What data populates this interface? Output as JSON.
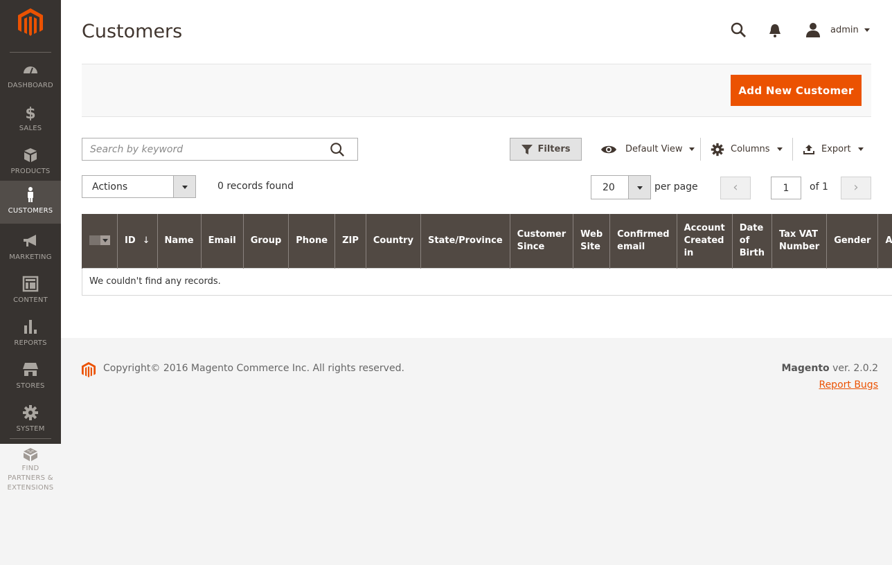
{
  "sidebar": {
    "items": [
      {
        "label": "DASHBOARD",
        "icon": "dashboard-icon",
        "active": false
      },
      {
        "label": "SALES",
        "icon": "dollar-icon",
        "active": false
      },
      {
        "label": "PRODUCTS",
        "icon": "box-icon",
        "active": false
      },
      {
        "label": "CUSTOMERS",
        "icon": "person-icon",
        "active": true
      },
      {
        "label": "MARKETING",
        "icon": "megaphone-icon",
        "active": false
      },
      {
        "label": "CONTENT",
        "icon": "layout-icon",
        "active": false
      },
      {
        "label": "REPORTS",
        "icon": "bar-chart-icon",
        "active": false
      },
      {
        "label": "STORES",
        "icon": "storefront-icon",
        "active": false
      },
      {
        "label": "SYSTEM",
        "icon": "gear-icon",
        "active": false
      }
    ],
    "partners_label_1": "FIND",
    "partners_label_2": "PARTNERS &",
    "partners_label_3": "EXTENSIONS"
  },
  "header": {
    "title": "Customers",
    "user": "admin"
  },
  "action_bar": {
    "add_button": "Add New Customer"
  },
  "toolbar": {
    "search_placeholder": "Search by keyword",
    "search_value": "",
    "filters": "Filters",
    "view": "Default View",
    "columns": "Columns",
    "export": "Export",
    "actions": "Actions",
    "records_found": "0 records found",
    "per_page_value": "20",
    "per_page_label": "per page",
    "current_page": "1",
    "total_pages_label": "of 1"
  },
  "grid": {
    "columns": [
      "ID",
      "Name",
      "Email",
      "Group",
      "Phone",
      "ZIP",
      "Country",
      "State/Province",
      "Customer Since",
      "Web Site",
      "Confirmed email",
      "Account Created in",
      "Date of Birth",
      "Tax VAT Number",
      "Gender",
      "Action"
    ],
    "sort_indicator": "↓",
    "empty_message": "We couldn't find any records."
  },
  "footer": {
    "copyright": "Copyright© 2016 Magento Commerce Inc. All rights reserved.",
    "brand": "Magento",
    "version": " ver. 2.0.2",
    "report_bugs": "Report Bugs"
  },
  "colors": {
    "accent": "#eb5202",
    "sidebar_bg": "#373330",
    "sidebar_active": "#524d49",
    "grid_header": "#514943"
  }
}
